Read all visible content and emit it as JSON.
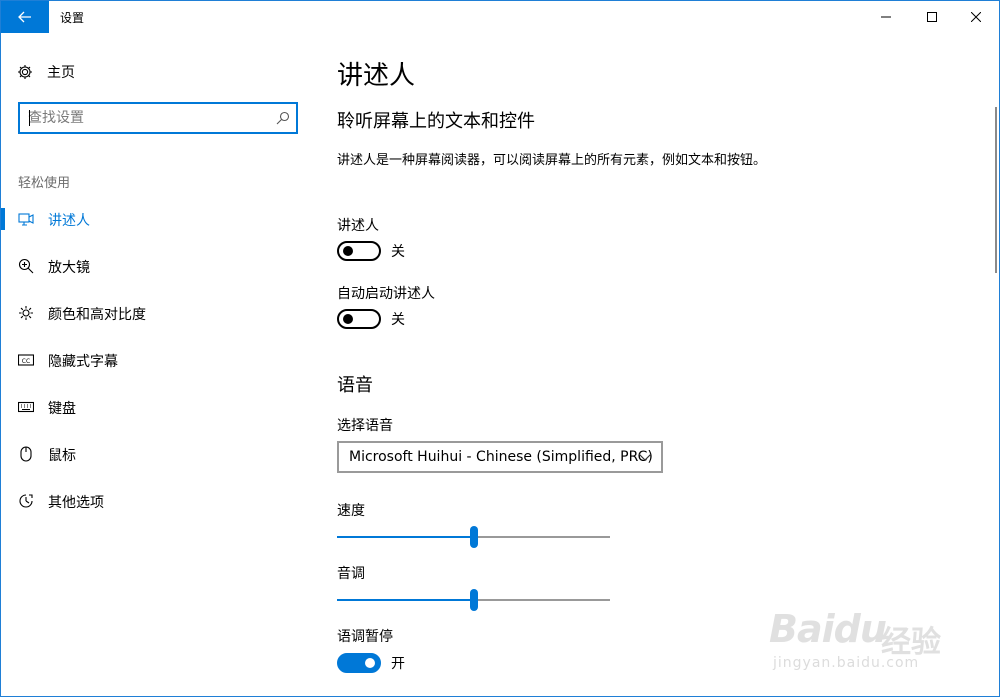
{
  "window": {
    "title": "设置"
  },
  "sidebar": {
    "home_label": "主页",
    "search_placeholder": "查找设置",
    "section_label": "轻松使用",
    "items": [
      {
        "label": "讲述人",
        "icon": "narrator-icon",
        "active": true
      },
      {
        "label": "放大镜",
        "icon": "magnifier-icon"
      },
      {
        "label": "颜色和高对比度",
        "icon": "brightness-icon"
      },
      {
        "label": "隐藏式字幕",
        "icon": "closed-captions-icon"
      },
      {
        "label": "键盘",
        "icon": "keyboard-icon"
      },
      {
        "label": "鼠标",
        "icon": "mouse-icon"
      },
      {
        "label": "其他选项",
        "icon": "other-options-icon"
      }
    ]
  },
  "main": {
    "title": "讲述人",
    "subtitle": "聆听屏幕上的文本和控件",
    "description": "讲述人是一种屏幕阅读器，可以阅读屏幕上的所有元素，例如文本和按钮。",
    "narrator": {
      "label": "讲述人",
      "state": "关",
      "on": false
    },
    "auto_start": {
      "label": "自动启动讲述人",
      "state": "关",
      "on": false
    },
    "voice_section": "语音",
    "voice_select": {
      "label": "选择语音",
      "value": "Microsoft Huihui - Chinese (Simplified, PRC)"
    },
    "speed": {
      "label": "速度",
      "value": 50
    },
    "pitch": {
      "label": "音调",
      "value": 50
    },
    "intonation_pause": {
      "label": "语调暂停",
      "state": "开",
      "on": true
    }
  },
  "watermark": {
    "brand": "Baidu",
    "product": "经验",
    "url": "jingyan.baidu.com"
  },
  "colors": {
    "accent": "#0078d7"
  }
}
